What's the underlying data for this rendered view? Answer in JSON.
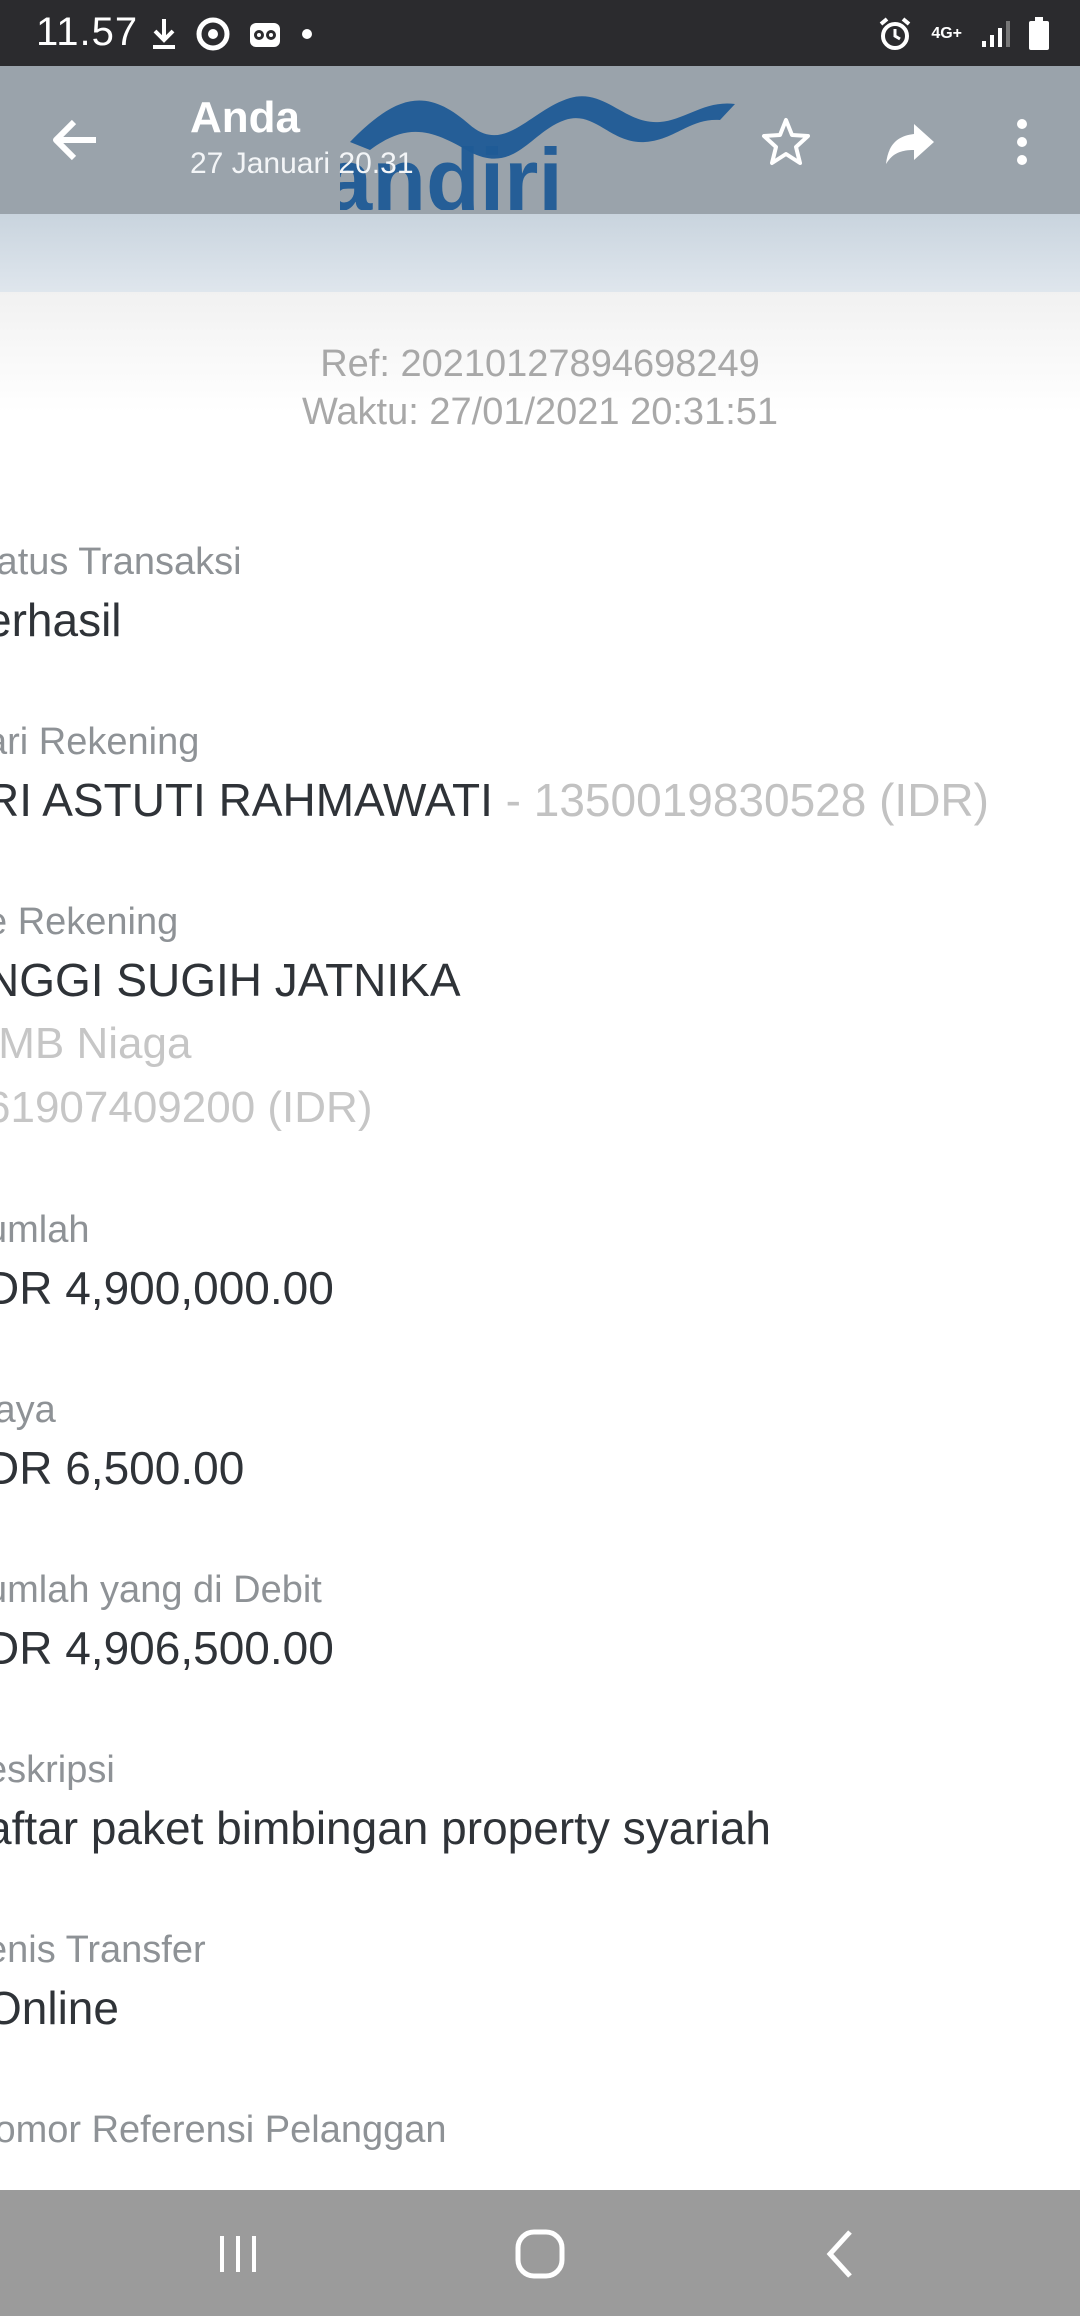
{
  "status_bar": {
    "time": "11.57",
    "network": "4G+",
    "icons": [
      "download-icon",
      "navigation-app-icon",
      "tripadvisor-icon",
      "dot-icon",
      "alarm-icon",
      "signal-icon",
      "battery-icon"
    ]
  },
  "app_bar": {
    "title": "Anda",
    "subtitle": "27 Januari 20.31",
    "logo_text": "mandiri",
    "colors": {
      "bar": "#9aa3ab",
      "logo": "#1f5b96"
    }
  },
  "receipt": {
    "ref": "Ref: 20210127894698249",
    "time": "Waktu: 27/01/2021 20:31:51",
    "fields": [
      {
        "label": "tatus Transaksi",
        "value": "erhasil"
      },
      {
        "label": "ari Rekening",
        "value": "RI ASTUTI RAHMAWATI",
        "value_muted": " - 1350019830528 (IDR)"
      },
      {
        "label": "e Rekening",
        "value": "NGGI SUGIH JATNIKA",
        "sub1": "IMB Niaga",
        "sub2": "61907409200 (IDR)"
      },
      {
        "label": "umlah",
        "value": "DR 4,900,000.00"
      },
      {
        "label": "iaya",
        "value": "DR 6,500.00"
      },
      {
        "label": "umlah yang di Debit",
        "value": "DR 4,906,500.00"
      },
      {
        "label": "eskripsi",
        "value": "aftar paket bimbingan property syariah"
      },
      {
        "label": "enis Transfer",
        "value": "Online"
      },
      {
        "label": "lomor Referensi Pelanggan"
      }
    ]
  }
}
